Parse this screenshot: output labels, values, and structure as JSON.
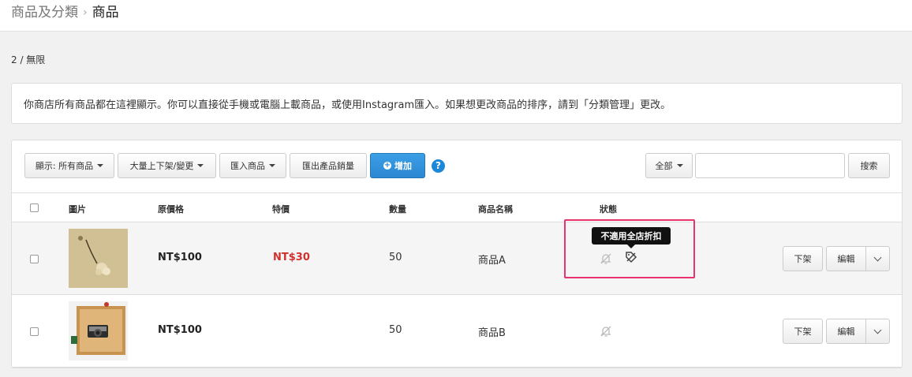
{
  "breadcrumb": {
    "parent": "商品及分類",
    "current": "商品"
  },
  "count_text": "2 / 無限",
  "info_text": "你商店所有商品都在這裡顯示。你可以直接從手機或電腦上載商品，或使用Instagram匯入。如果想更改商品的排序，請到「分類管理」更改。",
  "toolbar": {
    "filter_label": "顯示: 所有商品",
    "bulk_label": "大量上下架/變更",
    "import_label": "匯入商品",
    "export_label": "匯出產品銷量",
    "add_label": "增加",
    "help_label": "?",
    "scope_label": "全部",
    "search_value": "",
    "search_placeholder": "",
    "search_label": "搜索"
  },
  "table": {
    "headers": {
      "image": "圖片",
      "price": "原價格",
      "sale": "特價",
      "qty": "數量",
      "name": "商品名稱",
      "status": "狀態"
    },
    "rows": [
      {
        "price": "NT$100",
        "sale": "NT$30",
        "qty": "50",
        "name": "商品A",
        "unpublish_label": "下架",
        "edit_label": "編輯",
        "status_icons": [
          "bell-off-icon",
          "discount-off-icon"
        ]
      },
      {
        "price": "NT$100",
        "sale": "",
        "qty": "50",
        "name": "商品B",
        "unpublish_label": "下架",
        "edit_label": "編輯",
        "status_icons": [
          "bell-off-icon"
        ]
      }
    ]
  },
  "tooltip": {
    "text": "不適用全店折扣"
  },
  "colors": {
    "accent": "#2b87d1",
    "sale": "#d0312d",
    "highlight": "#e8336d"
  }
}
